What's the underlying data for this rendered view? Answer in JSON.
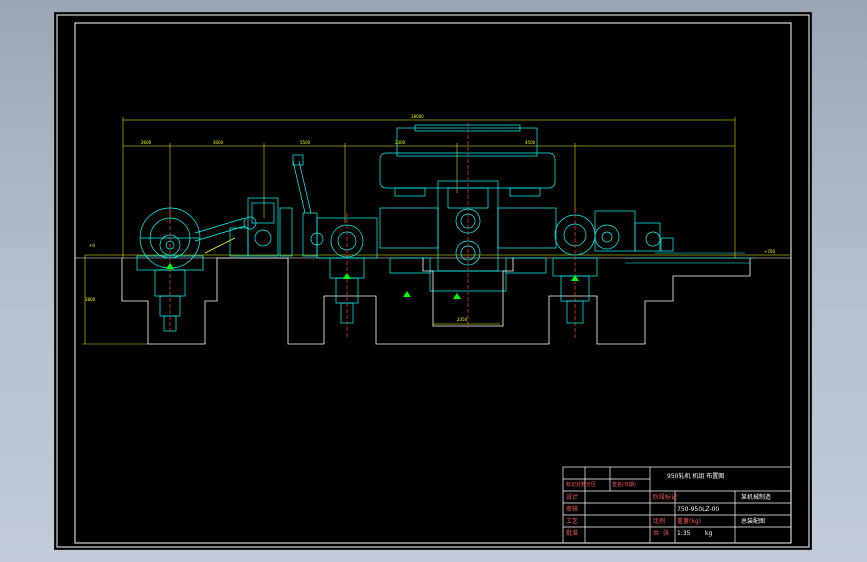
{
  "colors": {
    "background": "#000000",
    "outline": "#ffffff",
    "equipment": "#00ffff",
    "dimension": "#ffff00",
    "centerline": "#ff4040",
    "marker": "#00ff00",
    "titleblock_text": "#ffffff"
  },
  "dimensions": {
    "overall": "18000",
    "seg1": "2600",
    "seg2": "3000",
    "seg3": "5500",
    "seg4": "2300",
    "seg5": "4500",
    "left_gauge": "+0",
    "right_gauge": "+700",
    "pit_depth": "2800",
    "mill_pit": "2350"
  },
  "title_block": {
    "drawing_name": "950轧机 机组 布置图",
    "drawing_no": "750-950LZ-00",
    "scale": "1:35",
    "weight_unit": "kg",
    "label_designer": "设计",
    "label_checker": "审核",
    "label_process": "工艺",
    "label_approve": "批准",
    "label_sign": "标记处数分区",
    "label_date": "签名(日期)",
    "label_stage": "阶段标记",
    "label_weight": "重量(kg)",
    "label_scale": "比例",
    "label_total": "共",
    "label_sheet": "张",
    "right_top": "某机械制造",
    "right_bottom": "总装配图"
  }
}
